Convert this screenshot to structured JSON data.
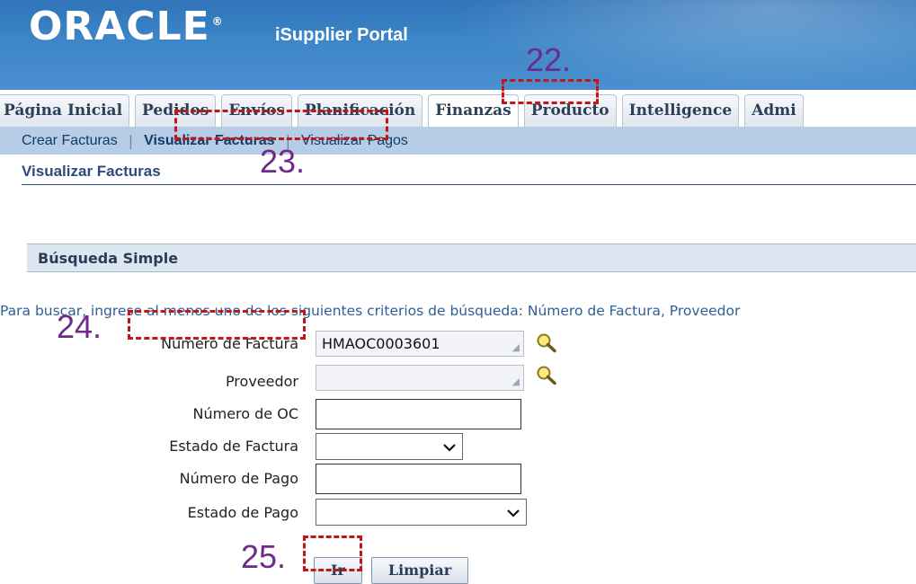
{
  "header": {
    "logo_text": "ORACLE",
    "logo_reg": "®",
    "portal_title": "iSupplier Portal"
  },
  "tabs": [
    {
      "label": "Página Inicial"
    },
    {
      "label": "Pedidos"
    },
    {
      "label": "Envíos"
    },
    {
      "label": "Planificación"
    },
    {
      "label": "Finanzas"
    },
    {
      "label": "Producto"
    },
    {
      "label": "Intelligence"
    },
    {
      "label": "Admi"
    }
  ],
  "subnav": {
    "items": [
      {
        "label": "Crear Facturas"
      },
      {
        "label": "Visualizar Facturas"
      },
      {
        "label": "Visualizar Pagos"
      }
    ],
    "separator": "|"
  },
  "page": {
    "title": "Visualizar Facturas"
  },
  "search": {
    "section_title": "Búsqueda Simple",
    "instructions": "Para buscar, ingrese al menos uno de los siguientes criterios de búsqueda: Número de Factura, Proveedor",
    "fields": {
      "invoice_number": {
        "label": "Número de Factura",
        "value": "HMAOC0003601"
      },
      "supplier": {
        "label": "Proveedor",
        "value": ""
      },
      "po_number": {
        "label": "Número de OC",
        "value": ""
      },
      "invoice_status": {
        "label": "Estado de Factura",
        "value": ""
      },
      "payment_number": {
        "label": "Número de Pago",
        "value": ""
      },
      "payment_status": {
        "label": "Estado de Pago",
        "value": ""
      }
    },
    "go_button": "Ir",
    "clear_button": "Limpiar"
  },
  "annotations": {
    "n22": "22.",
    "n23": "23.",
    "n24": "24.",
    "n25": "25."
  },
  "colors": {
    "banner": "#3d86c8",
    "subnav": "#b7cde6",
    "annotation_box": "#c01818",
    "annotation_number": "#6f2a8a"
  }
}
